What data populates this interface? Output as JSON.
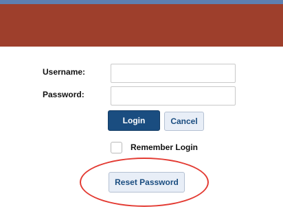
{
  "login_form": {
    "username_label": "Username:",
    "username_value": "",
    "password_label": "Password:",
    "password_value": "",
    "login_button": "Login",
    "cancel_button": "Cancel",
    "remember_label": "Remember Login",
    "remember_checked": false,
    "reset_button": "Reset Password"
  },
  "colors": {
    "banner": "#9e3f2c",
    "top_stripe": "#5e7fb0",
    "primary_button": "#1a4d80",
    "annotation_ring": "#e33a32"
  }
}
